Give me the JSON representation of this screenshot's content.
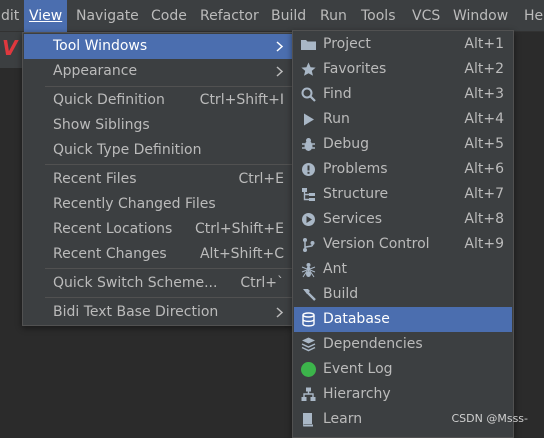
{
  "menubar": {
    "items": [
      {
        "label": "dit"
      },
      {
        "label": "View"
      },
      {
        "label": "Navigate"
      },
      {
        "label": "Code"
      },
      {
        "label": "Refactor"
      },
      {
        "label": "Build"
      },
      {
        "label": "Run"
      },
      {
        "label": "Tools"
      },
      {
        "label": "VCS"
      },
      {
        "label": "Window"
      },
      {
        "label": "He"
      }
    ]
  },
  "editor": {
    "fragment": "V"
  },
  "view_menu": {
    "items": [
      {
        "label": "Tool Windows",
        "shortcut": ""
      },
      {
        "label": "Appearance",
        "shortcut": ""
      },
      {
        "label": "Quick Definition",
        "shortcut": "Ctrl+Shift+I"
      },
      {
        "label": "Show Siblings",
        "shortcut": ""
      },
      {
        "label": "Quick Type Definition",
        "shortcut": ""
      },
      {
        "label": "Recent Files",
        "shortcut": "Ctrl+E"
      },
      {
        "label": "Recently Changed Files",
        "shortcut": ""
      },
      {
        "label": "Recent Locations",
        "shortcut": "Ctrl+Shift+E"
      },
      {
        "label": "Recent Changes",
        "shortcut": "Alt+Shift+C"
      },
      {
        "label": "Quick Switch Scheme...",
        "shortcut": "Ctrl+`"
      },
      {
        "label": "Bidi Text Base Direction",
        "shortcut": ""
      }
    ]
  },
  "tool_windows_menu": {
    "items": [
      {
        "label": "Project",
        "shortcut": "Alt+1",
        "icon": "folder-icon"
      },
      {
        "label": "Favorites",
        "shortcut": "Alt+2",
        "icon": "star-icon"
      },
      {
        "label": "Find",
        "shortcut": "Alt+3",
        "icon": "search-icon"
      },
      {
        "label": "Run",
        "shortcut": "Alt+4",
        "icon": "play-icon"
      },
      {
        "label": "Debug",
        "shortcut": "Alt+5",
        "icon": "bug-icon"
      },
      {
        "label": "Problems",
        "shortcut": "Alt+6",
        "icon": "warning-icon"
      },
      {
        "label": "Structure",
        "shortcut": "Alt+7",
        "icon": "structure-icon"
      },
      {
        "label": "Services",
        "shortcut": "Alt+8",
        "icon": "services-icon"
      },
      {
        "label": "Version Control",
        "shortcut": "Alt+9",
        "icon": "version-control-icon"
      },
      {
        "label": "Ant",
        "shortcut": "",
        "icon": "ant-icon"
      },
      {
        "label": "Build",
        "shortcut": "",
        "icon": "hammer-icon"
      },
      {
        "label": "Database",
        "shortcut": "",
        "icon": "database-icon"
      },
      {
        "label": "Dependencies",
        "shortcut": "",
        "icon": "dependencies-icon"
      },
      {
        "label": "Event Log",
        "shortcut": "",
        "icon": "event-log-icon"
      },
      {
        "label": "Hierarchy",
        "shortcut": "",
        "icon": "hierarchy-icon"
      },
      {
        "label": "Learn",
        "shortcut": "",
        "icon": "learn-icon"
      }
    ]
  },
  "watermark": "CSDN @Msss-",
  "colors": {
    "selection": "#4b6eaf",
    "menu_bg": "#3c3f41",
    "green_dot": "#3cb44b"
  }
}
